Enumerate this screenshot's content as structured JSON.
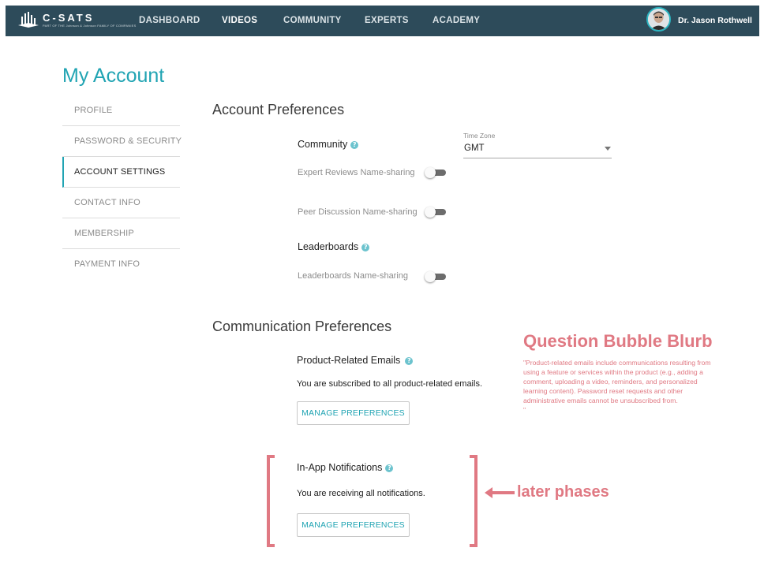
{
  "header": {
    "logo_text": "C-SATS",
    "logo_subtext": "PART OF THE Johnson & Johnson FAMILY OF COMPANIES",
    "nav": [
      {
        "label": "DASHBOARD"
      },
      {
        "label": "VIDEOS"
      },
      {
        "label": "COMMUNITY"
      },
      {
        "label": "EXPERTS"
      },
      {
        "label": "ACADEMY"
      }
    ],
    "active_nav": "VIDEOS",
    "user_name": "Dr. Jason Rothwell"
  },
  "page_title": "My Account",
  "sidebar": {
    "items": [
      {
        "label": "PROFILE"
      },
      {
        "label": "PASSWORD & SECURITY"
      },
      {
        "label": "ACCOUNT SETTINGS"
      },
      {
        "label": "CONTACT INFO"
      },
      {
        "label": "MEMBERSHIP"
      },
      {
        "label": "PAYMENT INFO"
      }
    ],
    "active": "ACCOUNT SETTINGS"
  },
  "account_preferences": {
    "title": "Account Preferences",
    "community": {
      "label": "Community",
      "expert_reviews_label": "Expert Reviews Name-sharing",
      "expert_reviews_on": false,
      "peer_discussion_label": "Peer Discussion Name-sharing",
      "peer_discussion_on": false
    },
    "leaderboards": {
      "label": "Leaderboards",
      "name_sharing_label": "Leaderboards Name-sharing",
      "name_sharing_on": false
    },
    "timezone": {
      "label": "Time Zone",
      "value": "GMT"
    }
  },
  "communication_preferences": {
    "title": "Communication Preferences",
    "product_emails": {
      "label": "Product-Related Emails",
      "status": "You are subscribed to all product-related emails.",
      "button": "MANAGE PREFERENCES"
    },
    "in_app": {
      "label": "In-App Notifications",
      "status": "You are receiving all notifications.",
      "button": "MANAGE PREFERENCES"
    }
  },
  "annotations": {
    "bubble_title": "Question Bubble Blurb",
    "bubble_body": "\"Product-related emails include communications resulting from using a feature or services within the product (e.g., adding a comment, uploading a video, reminders, and personalized learning content). Password reset requests and other administrative emails cannot be unsubscribed from.",
    "bubble_end": "\"",
    "phase_note": "later phases",
    "color": "#e07983"
  },
  "colors": {
    "header_bg": "#2d4b5a",
    "accent": "#21a4b3"
  },
  "icons": {
    "help": "question-circle-icon",
    "arrow": "left-arrow-icon",
    "caret": "chevron-down-icon"
  }
}
